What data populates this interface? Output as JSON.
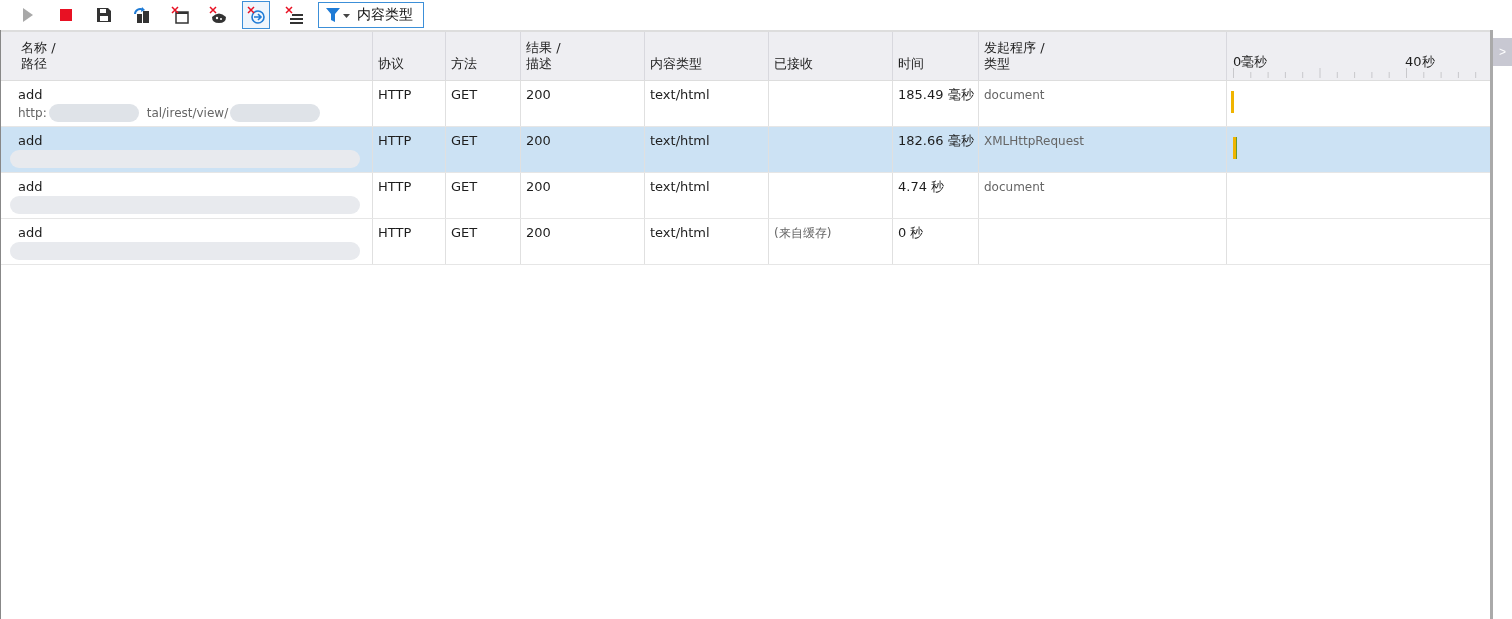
{
  "toolbar": {
    "buttons": [
      {
        "kind": "play",
        "disabled": true,
        "selected": false
      },
      {
        "kind": "stop",
        "disabled": false,
        "selected": false
      },
      {
        "kind": "save",
        "disabled": false,
        "selected": false
      },
      {
        "kind": "refresh",
        "disabled": false,
        "selected": false
      },
      {
        "kind": "clear-window",
        "disabled": false,
        "selected": false
      },
      {
        "kind": "clear-cookie",
        "disabled": false,
        "selected": false
      },
      {
        "kind": "clear-navigate",
        "disabled": false,
        "selected": true
      },
      {
        "kind": "clear-list",
        "disabled": false,
        "selected": false
      }
    ],
    "filter": {
      "label": "内容类型"
    }
  },
  "table": {
    "columns": [
      "名称 /\n路径",
      "协议",
      "方法",
      "结果 /\n描述",
      "内容类型",
      "已接收",
      "时间",
      "发起程序 /\n类型"
    ],
    "timeline_ticks": [
      "0毫秒",
      "40秒"
    ],
    "rows": [
      {
        "name": "add",
        "path_parts": [
          "http:",
          "tal/irest/view/"
        ],
        "protocol": "HTTP",
        "method": "GET",
        "result": "200",
        "content_type": "text/html",
        "received": "",
        "time": "185.49 毫秒",
        "initiator": "document",
        "bar": true,
        "selected": false
      },
      {
        "name": "add",
        "path_parts": [],
        "protocol": "HTTP",
        "method": "GET",
        "result": "200",
        "content_type": "text/html",
        "received": "",
        "time": "182.66 毫秒",
        "initiator": "XMLHttpRequest",
        "bar": true,
        "selected": true
      },
      {
        "name": "add",
        "path_parts": [],
        "protocol": "HTTP",
        "method": "GET",
        "result": "200",
        "content_type": "text/html",
        "received": "",
        "time": "4.74 秒",
        "initiator": "document",
        "bar": false,
        "selected": false
      },
      {
        "name": "add",
        "path_parts": [],
        "protocol": "HTTP",
        "method": "GET",
        "result": "200",
        "content_type": "text/html",
        "received": "(来自缓存)",
        "time": "0 秒",
        "initiator": "",
        "bar": false,
        "selected": false
      }
    ]
  },
  "side_button": {
    "label": ">"
  }
}
